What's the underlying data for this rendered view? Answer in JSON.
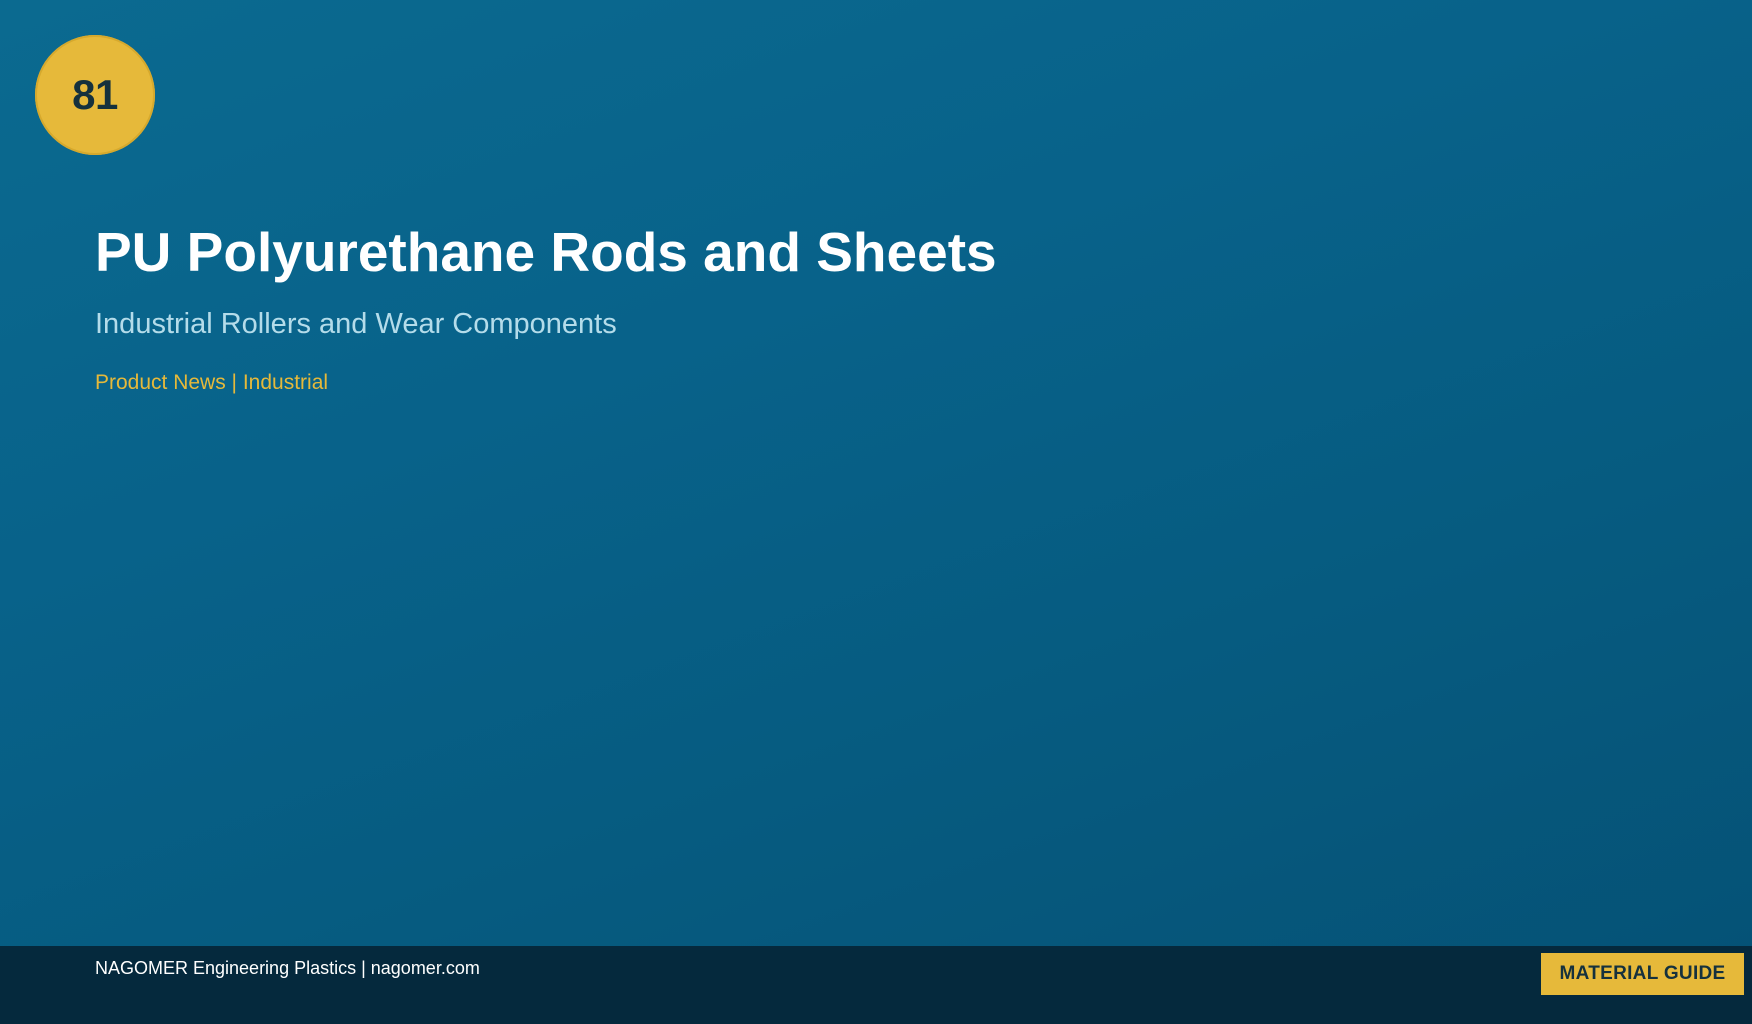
{
  "badge": {
    "number": "81"
  },
  "header": {
    "title": "PU Polyurethane Rods and Sheets",
    "subtitle": "Industrial Rollers and Wear Components",
    "category": "Product News | Industrial"
  },
  "footer": {
    "text": "NAGOMER Engineering Plastics | nagomer.com",
    "button_label": "MATERIAL GUIDE"
  },
  "colors": {
    "background": "#08628a",
    "accent": "#e6b93a",
    "footer": "#05293d",
    "title": "#ffffff",
    "subtitle": "#b4dcea"
  }
}
